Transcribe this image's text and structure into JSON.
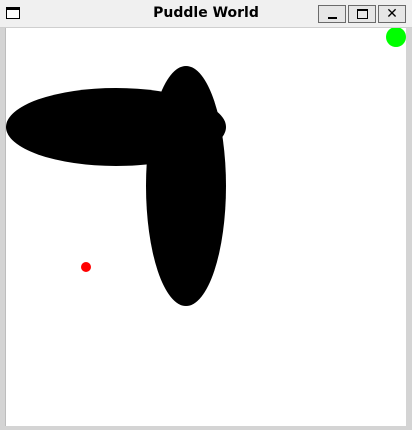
{
  "window": {
    "title": "Puddle World",
    "buttons": {
      "minimize_icon": "minimize-icon",
      "maximize_icon": "maximize-icon",
      "close_icon": "close-icon",
      "close_glyph": "✕"
    }
  },
  "world": {
    "background_color": "#ffffff",
    "puddle_color": "#000000",
    "puddle_count": 2,
    "agent": {
      "color": "#ff0000"
    },
    "goal": {
      "color": "#00ff00"
    }
  }
}
